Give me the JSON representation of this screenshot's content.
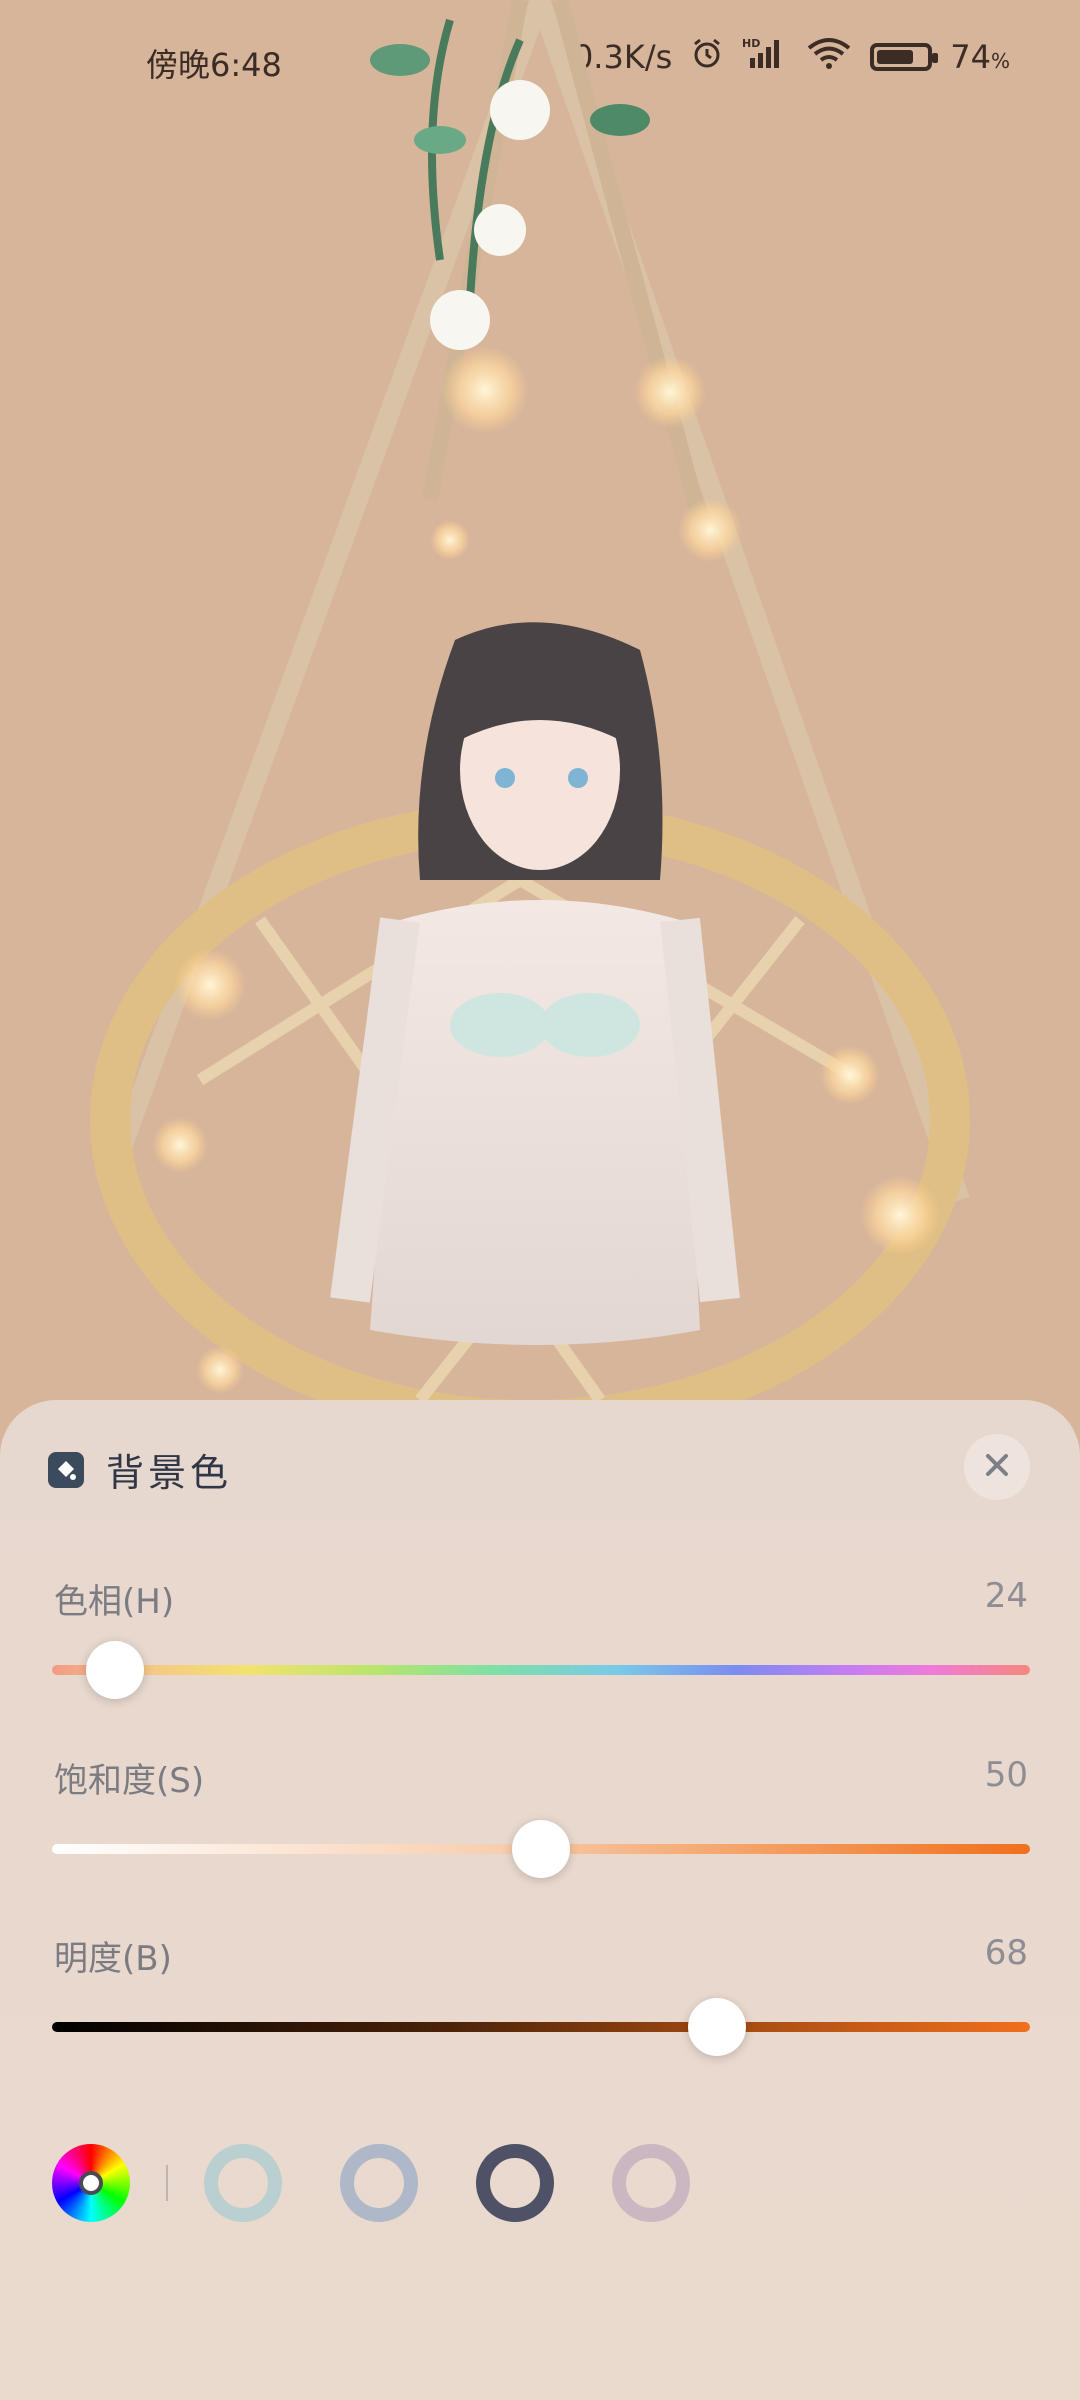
{
  "status": {
    "time": "傍晚6:48",
    "network_speed": "40.3K/s",
    "battery_text": "74",
    "battery_unit": "%",
    "battery_level": 0.74,
    "icons": [
      "alarm-icon",
      "signal-hd-icon",
      "wifi-icon",
      "battery-icon"
    ]
  },
  "panel": {
    "title": "背景色",
    "icon": "paint-bucket-icon",
    "close_icon": "close-icon",
    "sliders": [
      {
        "label": "色相(H)",
        "value": "24",
        "fraction": 0.064
      },
      {
        "label": "饱和度(S)",
        "value": "50",
        "fraction": 0.5
      },
      {
        "label": "明度(B)",
        "value": "68",
        "fraction": 0.68
      }
    ],
    "swatches": [
      {
        "name": "color-wheel",
        "colors": [
          "#ff0000",
          "#ffff00",
          "#00ff00",
          "#00ffff",
          "#0000ff",
          "#ff00ff"
        ]
      },
      {
        "name": "mint",
        "color": "#b9cfd0"
      },
      {
        "name": "blue-gray",
        "color": "#aeb8c9"
      },
      {
        "name": "navy",
        "color": "#4f5266"
      },
      {
        "name": "mauve",
        "color": "#cbb7c2"
      }
    ]
  },
  "colors": {
    "background": "#d7b59b",
    "panel": "#e8d8ce",
    "accent": "#f07a24"
  }
}
